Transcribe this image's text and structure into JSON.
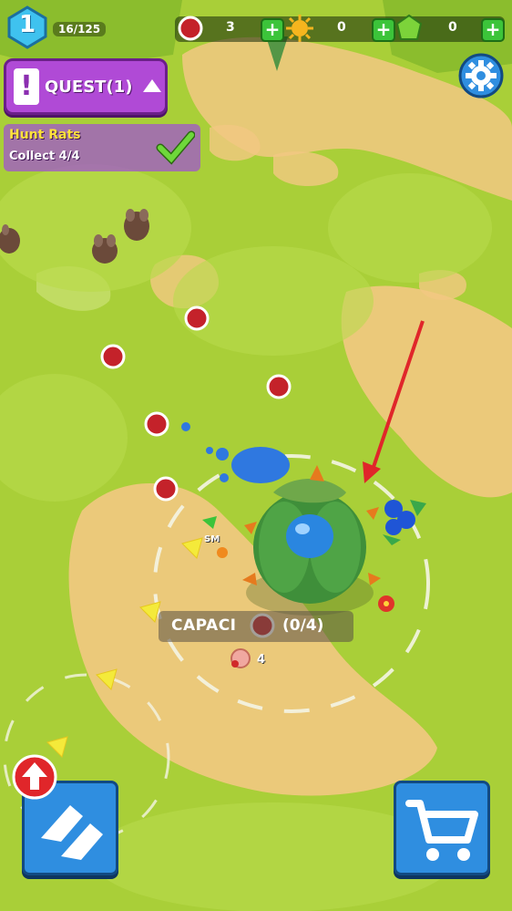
{
  "hud": {
    "level": "1",
    "xp": "16/125",
    "meat_count": "3",
    "sun_count": "0",
    "gem_count": "0",
    "plus_label": "+"
  },
  "quest": {
    "button_label": "QUEST(1)",
    "exclaim": "!",
    "title": "Hunt Rats",
    "progress": "Collect 4/4",
    "completed": true
  },
  "field": {
    "capacity_label": "CAPACI",
    "capacity_count": "(0/4)",
    "worm_count": "4",
    "floating_tag": "SM"
  },
  "colors": {
    "grass": "#a9cf38",
    "dirt": "#f2c882",
    "quest_purple": "#b04ad6",
    "button_blue": "#2f8ee0",
    "arrow_red": "#e0262a"
  },
  "icons": {
    "settings": "gear-icon",
    "shop": "cart-icon",
    "evolve": "chevron-up-icon",
    "upgrade_badge": "up-arrow-icon",
    "quest_check": "check-icon"
  }
}
